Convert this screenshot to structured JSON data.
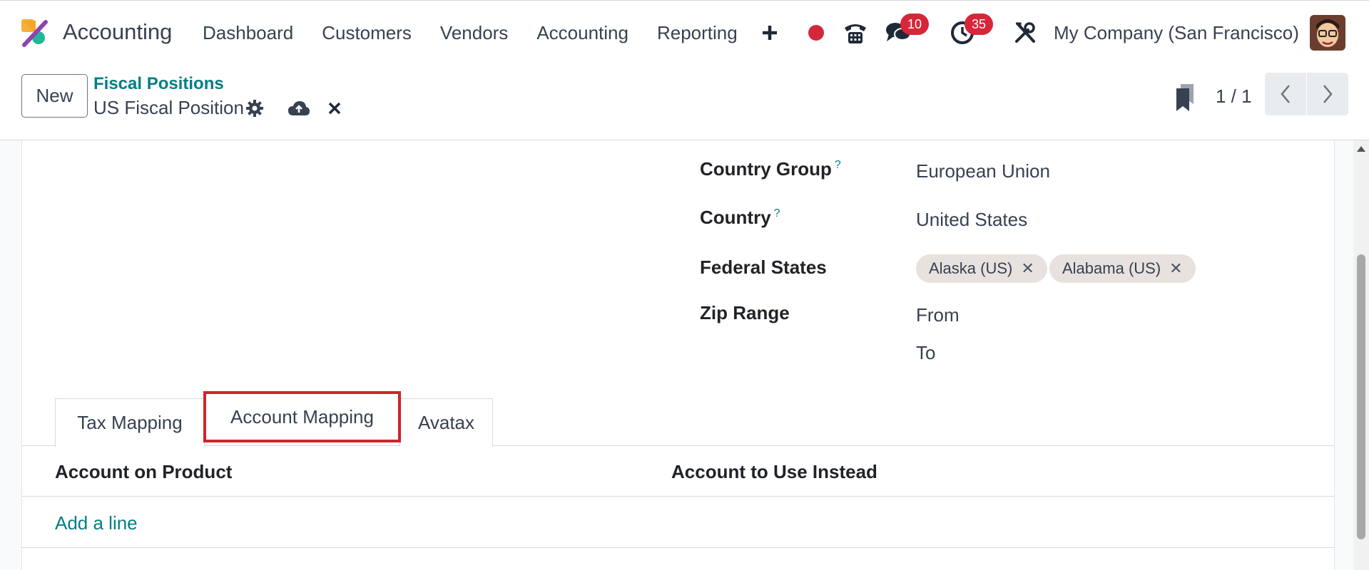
{
  "navbar": {
    "app_name": "Accounting",
    "menu": [
      "Dashboard",
      "Customers",
      "Vendors",
      "Accounting",
      "Reporting"
    ],
    "messages_badge": "10",
    "activities_badge": "35",
    "company": "My Company (San Francisco)",
    "icons": [
      "plus-icon",
      "record-dot-icon",
      "phone-icon",
      "chat-icon",
      "clock-icon",
      "tools-icon"
    ],
    "record_dot_color": "#d6263a"
  },
  "control_panel": {
    "new_label": "New",
    "breadcrumb": "Fiscal Positions",
    "record_name": "US Fiscal Position",
    "pager": "1 / 1"
  },
  "form": {
    "country_group": {
      "label": "Country Group",
      "help": "?",
      "value": "European Union"
    },
    "country": {
      "label": "Country",
      "help": "?",
      "value": "United States"
    },
    "federal_states": {
      "label": "Federal States",
      "tags": [
        "Alaska (US)",
        "Alabama (US)"
      ],
      "remove_glyph": "✕"
    },
    "zip_range": {
      "label": "Zip Range",
      "from": "From",
      "to": "To"
    }
  },
  "tabs": [
    {
      "label": "Tax Mapping",
      "active": false
    },
    {
      "label": "Account Mapping",
      "active": true
    },
    {
      "label": "Avatax",
      "active": false
    }
  ],
  "account_mapping": {
    "columns": [
      "Account on Product",
      "Account to Use Instead"
    ],
    "add_line": "Add a line"
  },
  "colors": {
    "accent": "#017e84",
    "highlight": "#d0232f",
    "badge": "#d6263a"
  }
}
